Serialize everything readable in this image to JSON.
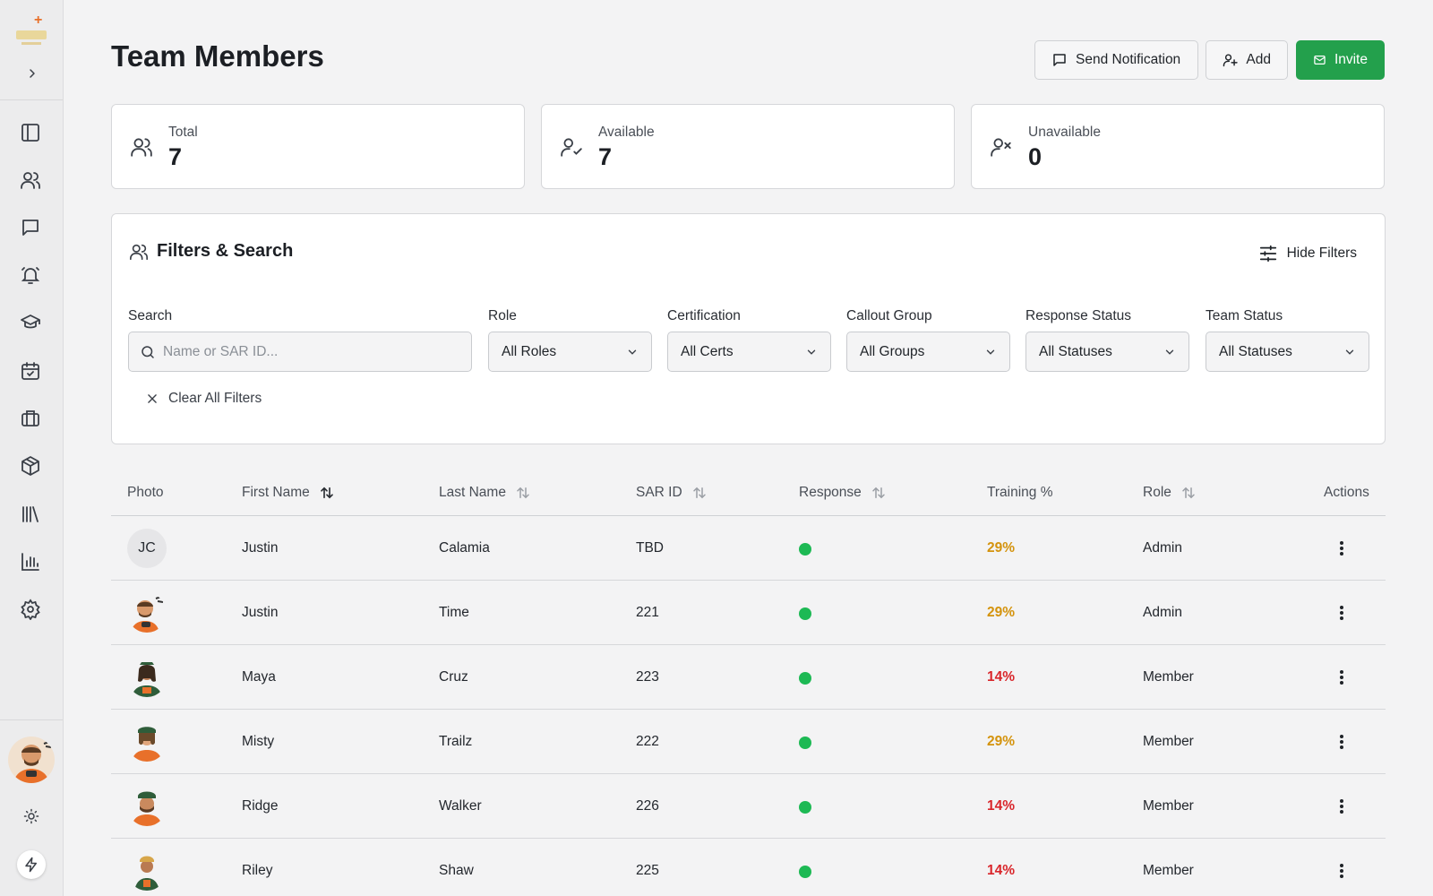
{
  "page": {
    "title": "Team Members"
  },
  "header_buttons": {
    "notify": "Send Notification",
    "add": "Add",
    "invite": "Invite"
  },
  "stats": [
    {
      "label": "Total",
      "value": "7"
    },
    {
      "label": "Available",
      "value": "7"
    },
    {
      "label": "Unavailable",
      "value": "0"
    }
  ],
  "filters": {
    "title": "Filters & Search",
    "hide_label": "Hide Filters",
    "search_label": "Search",
    "search_placeholder": "Name or SAR ID...",
    "fields": [
      {
        "label": "Role",
        "value": "All Roles"
      },
      {
        "label": "Certification",
        "value": "All Certs"
      },
      {
        "label": "Callout Group",
        "value": "All Groups"
      },
      {
        "label": "Response Status",
        "value": "All Statuses"
      },
      {
        "label": "Team Status",
        "value": "All Statuses"
      }
    ],
    "clear_label": "Clear All Filters"
  },
  "table": {
    "columns": [
      "Photo",
      "First Name",
      "Last Name",
      "SAR ID",
      "Response",
      "Training %",
      "Role",
      "Actions"
    ],
    "rows": [
      {
        "initials": "JC",
        "first": "Justin",
        "last": "Calamia",
        "sar_id": "TBD",
        "training": "29%",
        "role": "Admin"
      },
      {
        "initials": "",
        "first": "Justin",
        "last": "Time",
        "sar_id": "221",
        "training": "29%",
        "role": "Admin"
      },
      {
        "initials": "",
        "first": "Maya",
        "last": "Cruz",
        "sar_id": "223",
        "training": "14%",
        "role": "Member"
      },
      {
        "initials": "",
        "first": "Misty",
        "last": "Trailz",
        "sar_id": "222",
        "training": "29%",
        "role": "Member"
      },
      {
        "initials": "",
        "first": "Ridge",
        "last": "Walker",
        "sar_id": "226",
        "training": "14%",
        "role": "Member"
      },
      {
        "initials": "",
        "first": "Riley",
        "last": "Shaw",
        "sar_id": "225",
        "training": "14%",
        "role": "Member"
      }
    ]
  },
  "colors": {
    "accent": "#23a04c",
    "available_dot": "#1db954",
    "training_mid": "#d4930d",
    "training_low": "#d9262b"
  }
}
